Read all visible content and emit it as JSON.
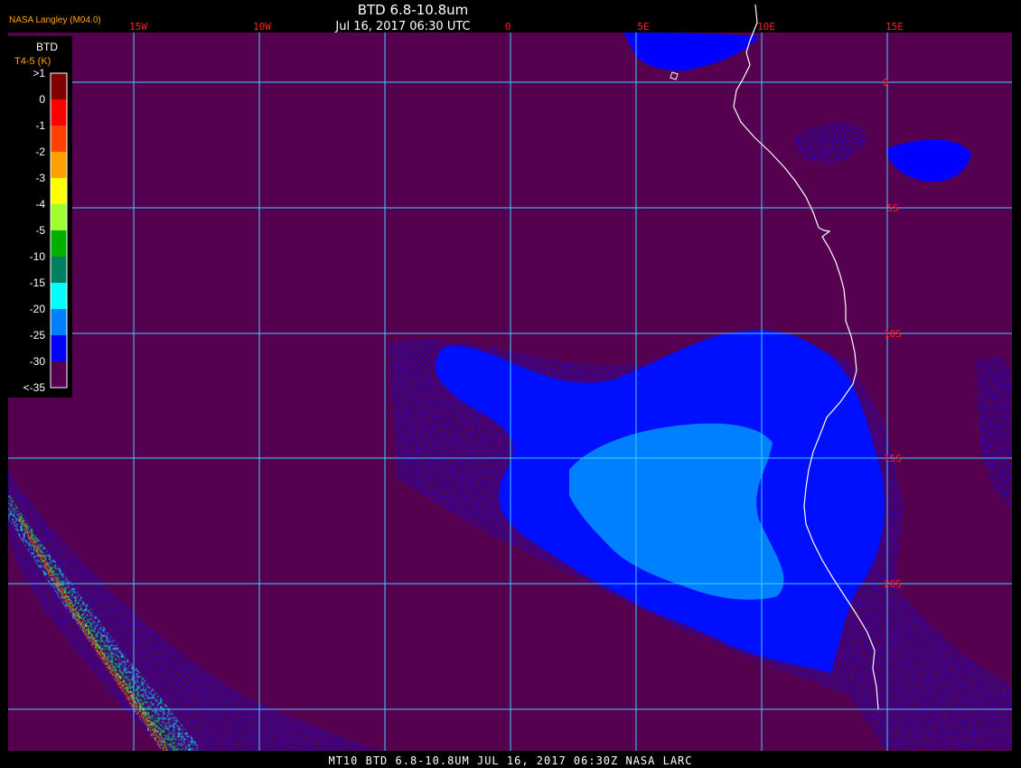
{
  "header": {
    "title": "BTD 6.8-10.8um",
    "datetime": "Jul 16, 2017 06:30 UTC",
    "credit": "NASA Langley (M04.0)"
  },
  "footer": {
    "caption": "MT10  BTD 6.8-10.8UM   JUL 16, 2017 06:30Z   NASA LARC"
  },
  "map": {
    "background_color": "#560050",
    "grid_color": "#40d0ff",
    "coastline_color": "#ffffff",
    "lon_labels": [
      "15W",
      "10W",
      "0",
      "5E",
      "10E",
      "15E"
    ],
    "lat_labels": [
      "0",
      "5S",
      "10S",
      "15S",
      "20S"
    ]
  },
  "legend": {
    "title": "BTD",
    "units": "T4-5 (K)",
    "ticks": [
      ">1",
      "0",
      "-1",
      "-2",
      "-3",
      "-4",
      "-5",
      "-10",
      "-15",
      "-20",
      "-25",
      "-30",
      "<-35"
    ],
    "colors": [
      "#800000",
      "#ff0000",
      "#ff4000",
      "#ffa000",
      "#ffff00",
      "#a0ff30",
      "#00b000",
      "#008060",
      "#00ffff",
      "#0080ff",
      "#0000ff",
      "#560050"
    ]
  }
}
